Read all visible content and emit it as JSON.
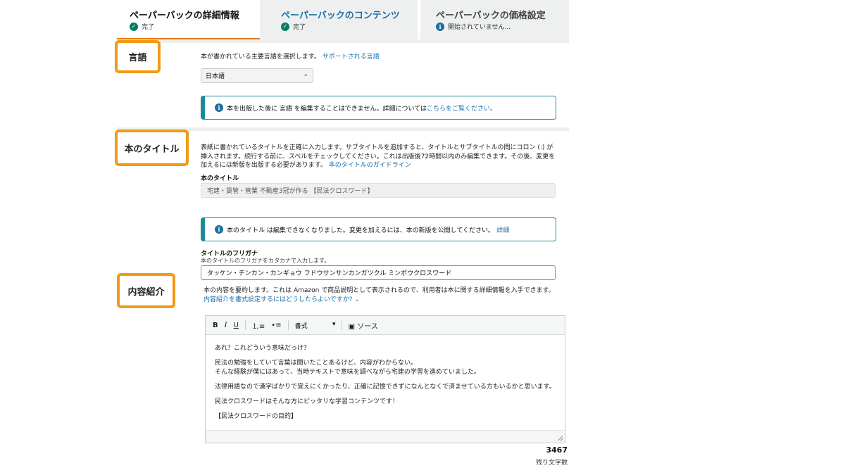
{
  "tabs": [
    {
      "label": "ペーパーバックの詳細情報",
      "status": "完了"
    },
    {
      "label": "ペーパーバックのコンテンツ",
      "status": "完了"
    },
    {
      "label": "ペーパーバックの価格設定",
      "status": "開始されていません..."
    }
  ],
  "language": {
    "heading": "言語",
    "description": "本が書かれている主要言語を選択します。",
    "link": "サポートされる言語",
    "selected": "日本語",
    "alert_text": "本を出版した後に 言語 を編集することはできません。詳細については",
    "alert_link": "こちらをご覧ください。"
  },
  "title_section": {
    "heading": "本のタイトル",
    "description": "表紙に書かれているタイトルを正確に入力します。サブタイトルを追加すると、タイトルとサブタイトルの間にコロン (:) が挿入されます。続行する前に、スペルをチェックしてください。これは出版後72時間以内のみ編集できます。その後、変更を加えるには新版を出版する必要があります。",
    "link": "本のタイトルのガイドライン",
    "field_label": "本のタイトル",
    "field_value": "宅建・賃管・管業 不動産3冠が作る 【民法クロスワード】",
    "alert_text": "本のタイトル は編集できなくなりました。変更を加えるには、本の新版を公開してください。",
    "alert_link": "詳細",
    "furigana_label": "タイトルのフリガナ",
    "furigana_sub": "本のタイトルのフリガナをカタカナで入力します。",
    "furigana_value": "タッケン・チンカン・カンギョウ フドウサンサンカンガツクル ミンポウクロスワード"
  },
  "description_section": {
    "heading": "内容紹介",
    "description": "本の内容を要約します。これは Amazon で商品説明として表示されるので、利用者は本に関する詳細情報を入手できます。",
    "link": "内容紹介を書式設定するにはどうしたらよいですか?",
    "toolbar": {
      "bold": "B",
      "italic": "I",
      "underline": "U",
      "format": "書式",
      "source": "ソース"
    },
    "body": [
      "あれ？これどういう意味だっけ？",
      "民法の勉強をしていて言葉は聞いたことあるけど、内容がわからない。",
      "そんな経験が僕にはあって、当時テキストで意味を調べながら宅建の学習を進めていました。",
      "法律用語なので漢字ばかりで覚えにくかったり、正確に記憶できずになんとなくで済ませている方もいるかと思います。",
      "民法クロスワードはそんな方にピッタリな学習コンテンツです！",
      "【民法クロスワードの目的】"
    ],
    "remaining_count": "3467",
    "remaining_label": "残り文字数"
  },
  "colors": {
    "accent_orange": "#f29a14",
    "link_blue": "#1a6da8",
    "success_green": "#067d62",
    "alert_teal": "#1b8b9a"
  }
}
